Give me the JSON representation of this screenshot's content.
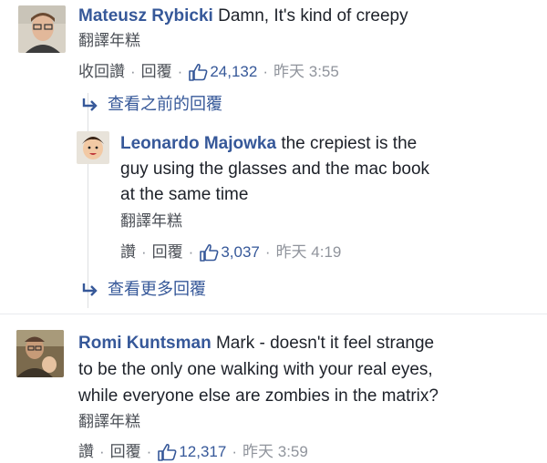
{
  "comments": [
    {
      "author": "Mateusz Rybicki",
      "lines": [
        "Damn, It's kind of creepy"
      ],
      "translate": "翻譯年糕",
      "actions": {
        "undo_like": "收回讚",
        "reply": "回覆",
        "likes": "24,132",
        "time": "昨天 3:55"
      }
    },
    {
      "author": "Leonardo Majowka",
      "lines": [
        "the crepiest is the",
        "guy using the glasses and the mac book",
        "at the same time"
      ],
      "translate": "翻譯年糕",
      "actions": {
        "like": "讚",
        "reply": "回覆",
        "likes": "3,037",
        "time": "昨天 4:19"
      }
    },
    {
      "author": "Romi Kuntsman",
      "lines": [
        "Mark - doesn't it feel strange",
        "to be the only one walking with your real eyes,",
        "while everyone else are zombies in the matrix?"
      ],
      "translate": "翻譯年糕",
      "actions": {
        "like": "讚",
        "reply": "回覆",
        "likes": "12,317",
        "time": "昨天 3:59"
      }
    }
  ],
  "view_previous_replies": "查看之前的回覆",
  "view_more_replies": "查看更多回覆",
  "colors": {
    "link": "#365899",
    "text": "#1d2129",
    "meta": "#90949c"
  },
  "icons": [
    "reply-arrow-icon",
    "thumbs-up-icon"
  ]
}
